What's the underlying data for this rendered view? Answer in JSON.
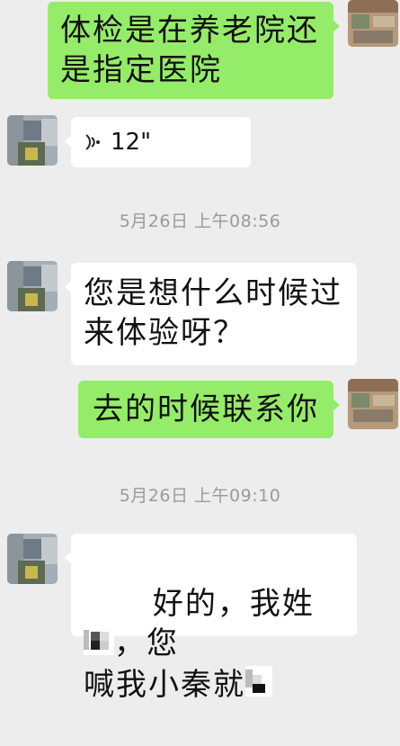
{
  "messages": {
    "m1": {
      "text": "体检是在养老院还\n是指定医院"
    },
    "m2": {
      "duration": "12\""
    },
    "ts1": "5月26日 上午08:56",
    "m3": {
      "text": "您是想什么时候过\n来体验呀？"
    },
    "m4": {
      "text": "去的时候联系你"
    },
    "ts2": "5月26日 上午09:10",
    "m5": {
      "line1_a": "好的，我姓",
      "line1_b": "，您",
      "line2": "喊我小秦就"
    }
  },
  "colors": {
    "background": "#ededed",
    "incoming_bubble": "#ffffff",
    "outgoing_bubble": "#95ec69",
    "timestamp": "#9a9a9a"
  },
  "icons": {
    "voice": "voice-wave-icon",
    "avatar_other": "blurred-avatar-image",
    "avatar_self": "blurred-avatar-image"
  }
}
